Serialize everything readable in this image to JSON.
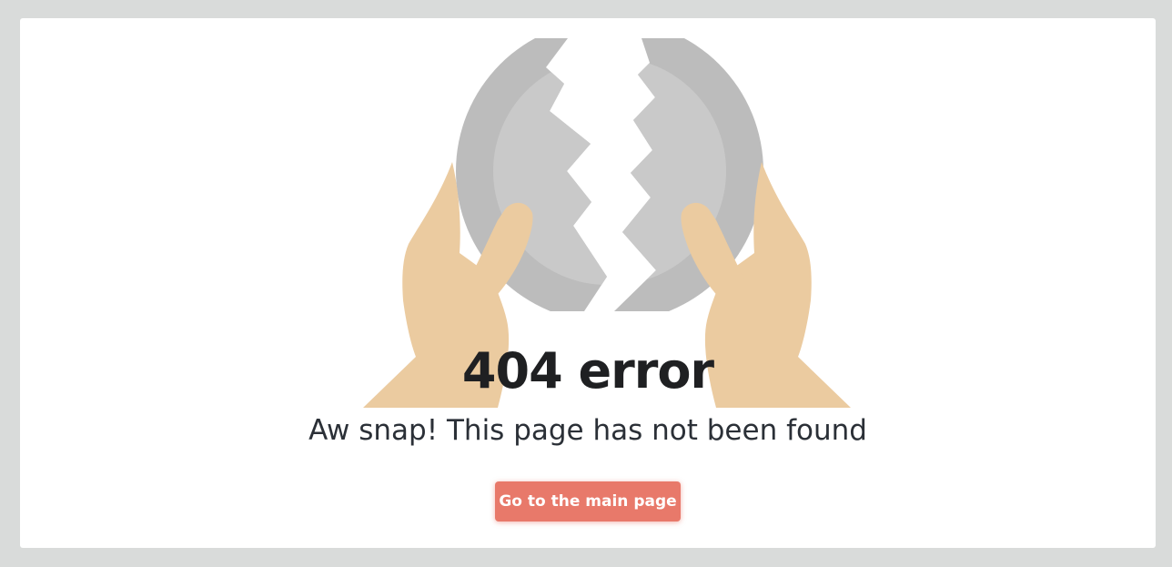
{
  "error": {
    "title": "404 error",
    "subtitle": "Aw snap! This page has not been found"
  },
  "actions": {
    "main_page_label": "Go to the main page"
  },
  "colors": {
    "page_background": "#d9dbda",
    "card_background": "#ffffff",
    "title_text": "#1f2022",
    "subtitle_text": "#2b3037",
    "button_background": "#e8796a",
    "button_text": "#ffffff",
    "disc_outer": "#bcbcbc",
    "disc_inner": "#c9c9c9",
    "hands": "#ebcba0"
  },
  "illustration": {
    "icon": "broken-disc-hands-illustration"
  }
}
